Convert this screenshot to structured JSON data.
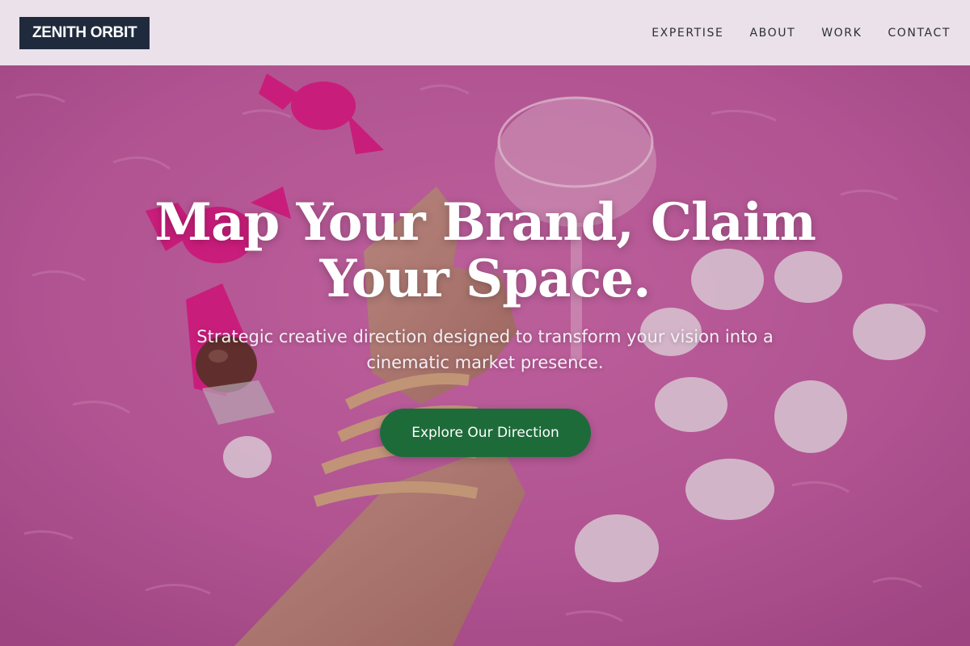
{
  "header": {
    "logo": "ZENITH ORBIT",
    "nav": [
      "EXPERTISE",
      "ABOUT",
      "WORK",
      "CONTACT"
    ]
  },
  "hero": {
    "title_line1": "Map Your Brand, Claim",
    "title_line2": "Your Space.",
    "subtitle_line1": "Strategic creative direction designed to transform your vision into a",
    "subtitle_line2": "cinematic market presence.",
    "cta": "Explore Our Direction"
  },
  "colors": {
    "header_bg": "#ebe1ea",
    "logo_bg": "#1f2a3d",
    "cta_bg": "#1e6b3a",
    "hero_bg": "#c0579a"
  }
}
